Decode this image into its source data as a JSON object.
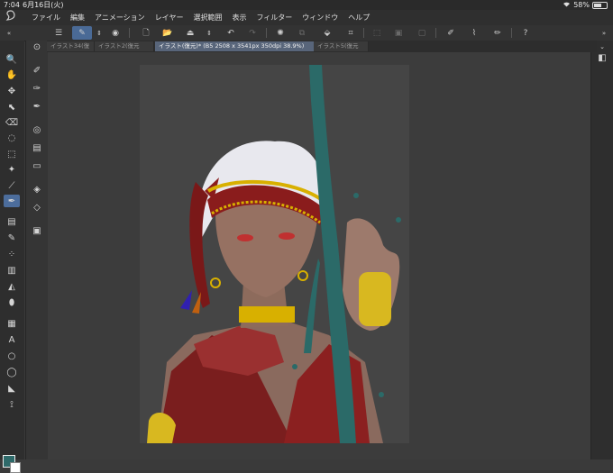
{
  "status": {
    "time": "7:04",
    "date": "6月16日(火)",
    "battery": "58%",
    "battery_level": 0.58
  },
  "menu": [
    "ファイル",
    "編集",
    "アニメーション",
    "レイヤー",
    "選択範囲",
    "表示",
    "フィルター",
    "ウィンドウ",
    "ヘルプ"
  ],
  "tabs": [
    {
      "label": "イラスト34(復"
    },
    {
      "label": "イラスト2(復元"
    },
    {
      "label": "イラスト(復元)* (B5 2508 x 3541px 350dpi 38.9%)"
    },
    {
      "label": "イラスト5(復元"
    }
  ],
  "colors": {
    "accent": "#4c6d9c",
    "main_color": "#2e6a6a",
    "sub_color": "#ffffff"
  },
  "icons": {
    "command_bar": [
      "menu-icon",
      "brush-settings-icon",
      "reference-icon",
      "new-file-icon",
      "open-file-icon",
      "save-icon",
      "undo-icon",
      "redo-icon",
      "loading-icon",
      "copy-icon",
      "fill-icon",
      "crop-icon",
      "pen-icon",
      "brush-icon",
      "pencil-icon",
      "help-icon"
    ],
    "tools": [
      "zoom-icon",
      "hand-icon",
      "move-icon",
      "operation-icon",
      "eraser-icon",
      "lasso-icon",
      "select-icon",
      "magic-wand-icon",
      "eyedropper-icon",
      "pen-tool-icon",
      "brush-tool-icon",
      "pencil-tool-icon",
      "airbrush-icon",
      "gradient-icon",
      "fill-bucket-icon",
      "figure-icon",
      "frame-icon",
      "text-icon",
      "circle-icon",
      "speech-bubble-icon",
      "ruler-icon",
      "correction-icon"
    ]
  }
}
